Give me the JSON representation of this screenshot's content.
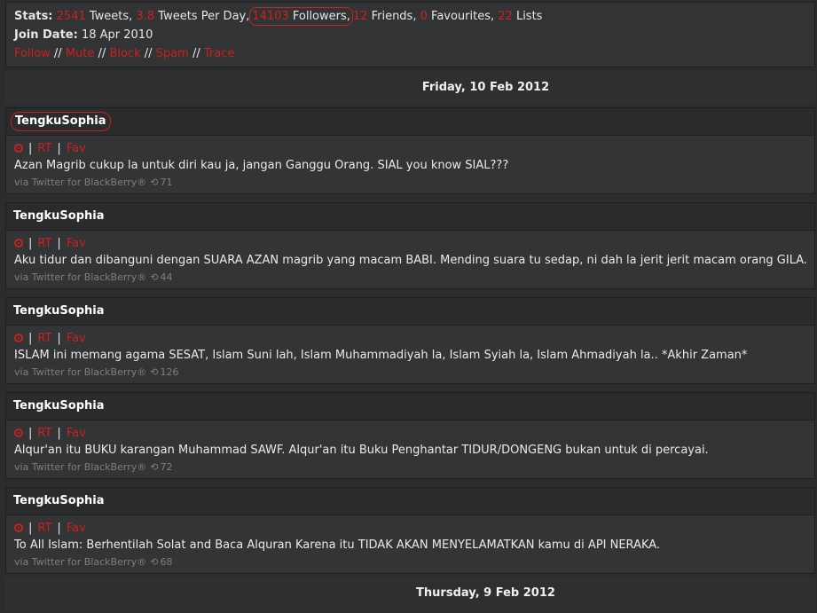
{
  "stats": {
    "label": "Stats:",
    "tweets_count": "2541",
    "tweets_label": "Tweets,",
    "per_day_value": "3.8",
    "per_day_label": "Tweets Per Day,",
    "followers_count": "14103",
    "followers_label": "Followers,",
    "friends_count": "12",
    "friends_label": "Friends,",
    "favourites_count": "0",
    "favourites_label": "Favourites,",
    "lists_count": "22",
    "lists_label": "Lists"
  },
  "join": {
    "label": "Join Date:",
    "value": "18 Apr 2010"
  },
  "profile_actions": {
    "follow": "Follow",
    "mute": "Mute",
    "block": "Block",
    "spam": "Spam",
    "trace": "Trace",
    "separator": "//"
  },
  "date_headers": {
    "first": "Friday, 10 Feb 2012",
    "second": "Thursday, 9 Feb 2012"
  },
  "tweet_actions": {
    "rt": "RT",
    "fav": "Fav",
    "separator": "|"
  },
  "tweets": [
    {
      "user": "TengkuSophia",
      "text": "Azan Magrib cukup la untuk diri kau ja, jangan Ganggu Orang. SIAL you know SIAL???",
      "via": "via Twitter for BlackBerry®",
      "retweets": "71"
    },
    {
      "user": "TengkuSophia",
      "text": "Aku tidur dan dibanguni dengan SUARA AZAN magrib yang macam BABI. Mending suara tu sedap, ni dah la jerit jerit macam orang GILA.",
      "via": "via Twitter for BlackBerry®",
      "retweets": "44"
    },
    {
      "user": "TengkuSophia",
      "text": "ISLAM ini memang agama SESAT, Islam Suni lah, Islam Muhammadiyah la, Islam Syiah la, Islam Ahmadiyah la.. *Akhir Zaman*",
      "via": "via Twitter for BlackBerry®",
      "retweets": "126"
    },
    {
      "user": "TengkuSophia",
      "text": "Alqur'an itu BUKU karangan Muhammad SAWF. Alqur'an itu Buku Penghantar TIDUR/DONGENG bukan untuk di percayai.",
      "via": "via Twitter for BlackBerry®",
      "retweets": "72"
    },
    {
      "user": "TengkuSophia",
      "text": "To All Islam: Berhentilah Solat and Baca Alquran Karena itu TIDAK AKAN MENYELAMATKAN kamu di API NERAKA.",
      "via": "via Twitter for BlackBerry®",
      "retweets": "68"
    }
  ],
  "colors": {
    "accent_red": "#c8221e",
    "background": "#2b2c2e",
    "panel": "#333436",
    "header": "#2a2b2d"
  },
  "icons": {
    "reply": "reply-icon",
    "retweet": "retweet-icon"
  }
}
